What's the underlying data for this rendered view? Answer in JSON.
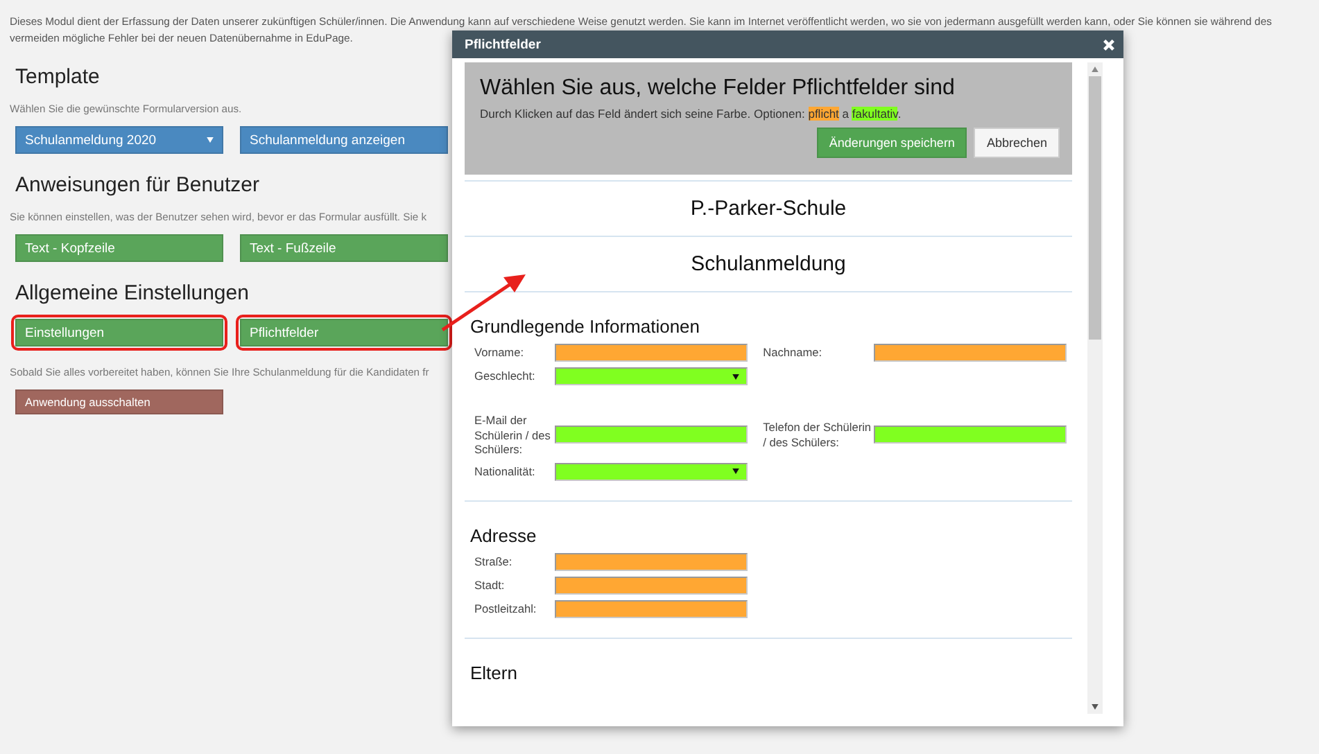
{
  "page": {
    "intro_lines": [
      "Dieses Modul dient der Erfassung der Daten unserer zukünftigen Schüler/innen. Die Anwendung kann auf verschiedene Weise genutzt werden. Sie kann im Internet veröffentlicht werden, wo sie von jedermann ausgefüllt werden kann, oder Sie können sie während des",
      "vermeiden mögliche Fehler bei der neuen Datenübernahme in EduPage."
    ],
    "sections": [
      {
        "title": "Template",
        "text": "Wählen Sie die gewünschte Formularversion aus.",
        "buttons": [
          {
            "label": "Schulanmeldung 2020",
            "kind": "dropdown",
            "color": "#4a89c0",
            "highlighted": false
          },
          {
            "label": "Schulanmeldung anzeigen",
            "kind": "button",
            "color": "#4a89c0",
            "highlighted": false
          }
        ]
      },
      {
        "title": "Anweisungen für Benutzer",
        "text": "Sie können einstellen, was der Benutzer sehen wird, bevor er das Formular ausfüllt. Sie k",
        "buttons": [
          {
            "label": "Text - Kopfzeile",
            "kind": "button",
            "color": "#5aa55a",
            "highlighted": false
          },
          {
            "label": "Text - Fußzeile",
            "kind": "button",
            "color": "#5aa55a",
            "highlighted": false
          }
        ]
      },
      {
        "title": "Allgemeine Einstellungen",
        "buttons": [
          {
            "label": "Einstellungen",
            "kind": "button",
            "color": "#5aa55a",
            "highlighted": true
          },
          {
            "label": "Pflichtfelder",
            "kind": "button",
            "color": "#5aa55a",
            "highlighted": true
          }
        ]
      },
      {
        "text": "Sobald Sie alles vorbereitet haben, können Sie Ihre Schulanmeldung für die Kandidaten fr",
        "buttons": [
          {
            "label": "Anwendung ausschalten",
            "kind": "small",
            "color": "#a0675e",
            "highlighted": false
          }
        ]
      }
    ]
  },
  "dialog": {
    "title": "Pflichtfelder",
    "heading": "Wählen Sie aus, welche Felder Pflichtfelder sind",
    "hint": {
      "intro": "Durch Klicken auf das Feld ändert sich seine Farbe. Optionen:",
      "options": [
        {
          "label": "pflicht",
          "required": true
        },
        {
          "label": "fakultativ",
          "required": false
        }
      ],
      "joiner": "a",
      "end": "."
    },
    "buttons": [
      {
        "label": "Änderungen speichern",
        "kind": "primary"
      },
      {
        "label": "Abbrechen",
        "kind": "default"
      }
    ],
    "school": "P.-Parker-Schule",
    "form_title": "Schulanmeldung",
    "sections": [
      {
        "title": "Grundlegende Informationen",
        "rows": [
          [
            {
              "label": "Vorname:",
              "kind": "text",
              "required": true
            },
            {
              "label": "Nachname:",
              "kind": "text",
              "required": true
            }
          ],
          [
            {
              "label": "Geschlecht:",
              "kind": "select",
              "required": false
            }
          ],
          [
            {
              "label": "E-Mail der Schülerin / des Schülers:",
              "kind": "text",
              "required": false
            },
            {
              "label": "Telefon der Schülerin / des Schülers:",
              "kind": "text",
              "required": false
            }
          ],
          [
            {
              "label": "Nationalität:",
              "kind": "select",
              "required": false
            }
          ]
        ]
      },
      {
        "title": "Adresse",
        "rows": [
          [
            {
              "label": "Straße:",
              "kind": "text",
              "required": true
            }
          ],
          [
            {
              "label": "Stadt:",
              "kind": "text",
              "required": true
            }
          ],
          [
            {
              "label": "Postleitzahl:",
              "kind": "text",
              "required": true
            }
          ]
        ]
      },
      {
        "title": "Eltern"
      }
    ]
  }
}
